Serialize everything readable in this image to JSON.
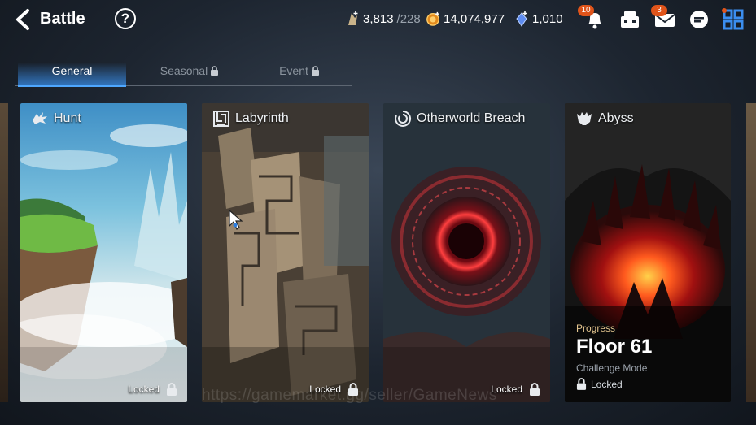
{
  "header": {
    "title": "Battle",
    "help_icon": "question-mark-icon",
    "resources": [
      {
        "icon": "stamina-icon",
        "value": "3,813",
        "max": "/228"
      },
      {
        "icon": "gold-coin-icon",
        "value": "14,074,977"
      },
      {
        "icon": "crystal-icon",
        "value": "1,010"
      }
    ],
    "notifications_badge": "10",
    "mail_badge": "3"
  },
  "tabs": [
    {
      "label": "General",
      "active": true
    },
    {
      "label": "Seasonal",
      "locked": true
    },
    {
      "label": "Event",
      "locked": true
    }
  ],
  "cards": [
    {
      "name": "Hunt",
      "status": "Locked",
      "icon": "dragon-icon"
    },
    {
      "name": "Labyrinth",
      "status": "Locked",
      "icon": "maze-icon"
    },
    {
      "name": "Otherworld Breach",
      "status": "Locked",
      "icon": "portal-icon"
    },
    {
      "name": "Abyss",
      "icon": "demon-icon",
      "progress_label": "Progress",
      "floor": "Floor 61",
      "mode": "Challenge Mode",
      "status": "Locked"
    }
  ],
  "watermark": "https://gamemarket.gg/seller/GameNews",
  "colors": {
    "accent": "#4ea7ff",
    "badge": "#e0541a",
    "gold": "#e3c58f"
  }
}
